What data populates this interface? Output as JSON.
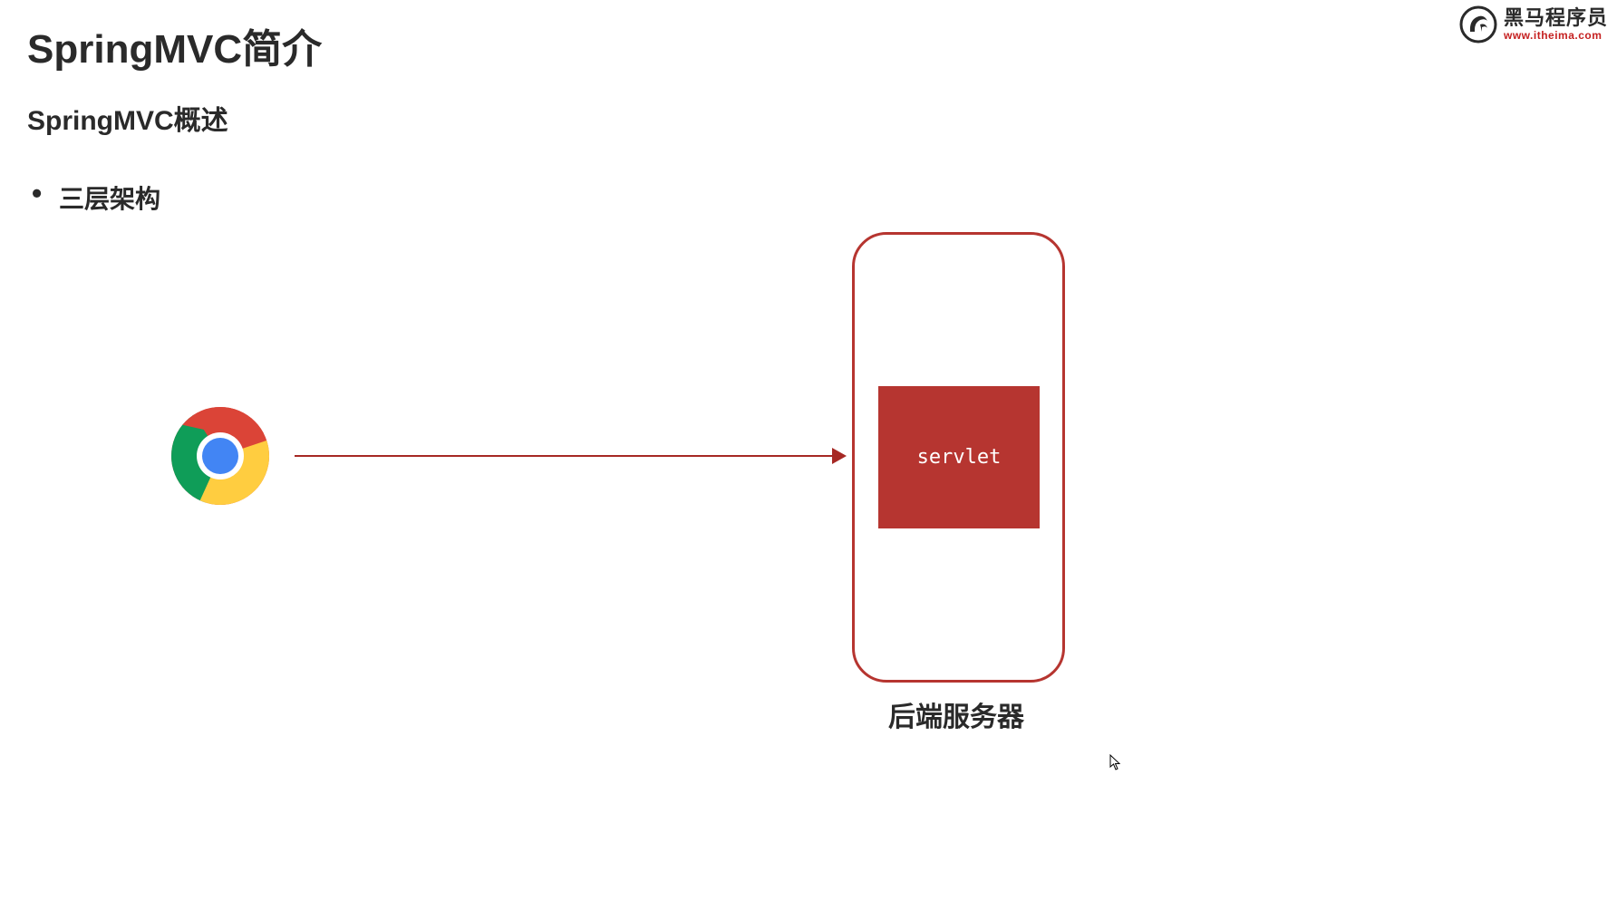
{
  "title": "SpringMVC简介",
  "subtitle": "SpringMVC概述",
  "bullet1": "三层架构",
  "logo": {
    "text": "黑马程序员",
    "url": "www.itheima.com"
  },
  "diagram": {
    "browser_icon": "chrome-icon",
    "servlet_label": "servlet",
    "server_label": "后端服务器"
  }
}
